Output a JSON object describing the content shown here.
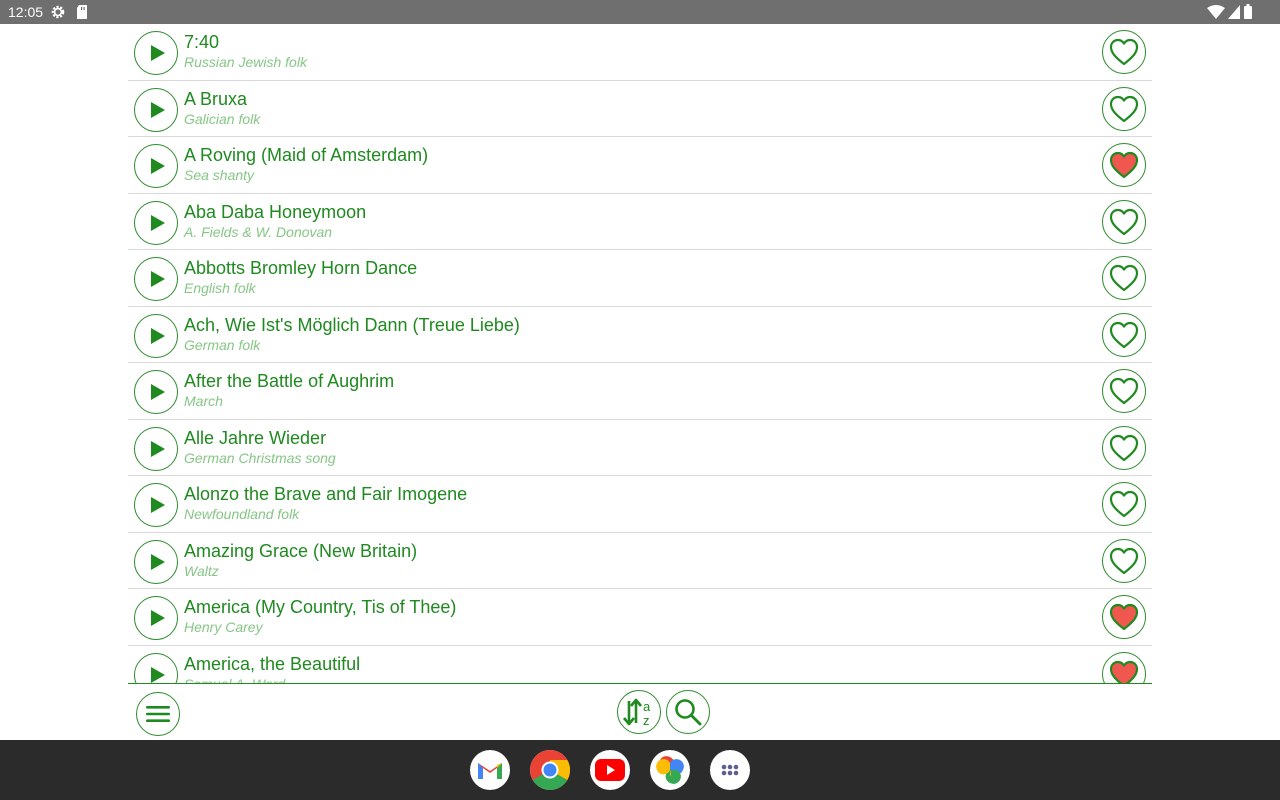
{
  "status_bar": {
    "time": "12:05",
    "icons": [
      "gear-icon",
      "sd-card-icon",
      "wifi-icon",
      "signal-icon",
      "battery-icon"
    ]
  },
  "songs": [
    {
      "title": "7:40",
      "subtitle": "Russian Jewish folk",
      "favorite": false
    },
    {
      "title": "A Bruxa",
      "subtitle": "Galician folk",
      "favorite": false
    },
    {
      "title": "A Roving (Maid of Amsterdam)",
      "subtitle": "Sea shanty",
      "favorite": true
    },
    {
      "title": "Aba Daba Honeymoon",
      "subtitle": "A. Fields & W. Donovan",
      "favorite": false
    },
    {
      "title": "Abbotts Bromley Horn Dance",
      "subtitle": "English folk",
      "favorite": false
    },
    {
      "title": "Ach, Wie Ist's Möglich Dann (Treue Liebe)",
      "subtitle": "German folk",
      "favorite": false
    },
    {
      "title": "After the Battle of Aughrim",
      "subtitle": "March",
      "favorite": false
    },
    {
      "title": "Alle Jahre Wieder",
      "subtitle": "German Christmas song",
      "favorite": false
    },
    {
      "title": "Alonzo the Brave and Fair Imogene",
      "subtitle": "Newfoundland folk",
      "favorite": false
    },
    {
      "title": "Amazing Grace (New Britain)",
      "subtitle": "Waltz",
      "favorite": false
    },
    {
      "title": "America (My Country, Tis of Thee)",
      "subtitle": "Henry Carey",
      "favorite": true
    },
    {
      "title": "America, the Beautiful",
      "subtitle": "Samuel A. Ward",
      "favorite": true
    }
  ],
  "toolbar": {
    "icons": [
      "menu-icon",
      "sort-az-icon",
      "search-icon"
    ]
  },
  "dock": {
    "apps": [
      "gmail-icon",
      "chrome-icon",
      "youtube-icon",
      "photos-icon",
      "app-drawer-icon"
    ]
  },
  "colors": {
    "accent": "#1f8a1f",
    "subtitle": "#86c686",
    "favorite_fill": "#f0574f",
    "status_bar": "#6f6f6f",
    "taskbar": "#2b2b2b"
  }
}
